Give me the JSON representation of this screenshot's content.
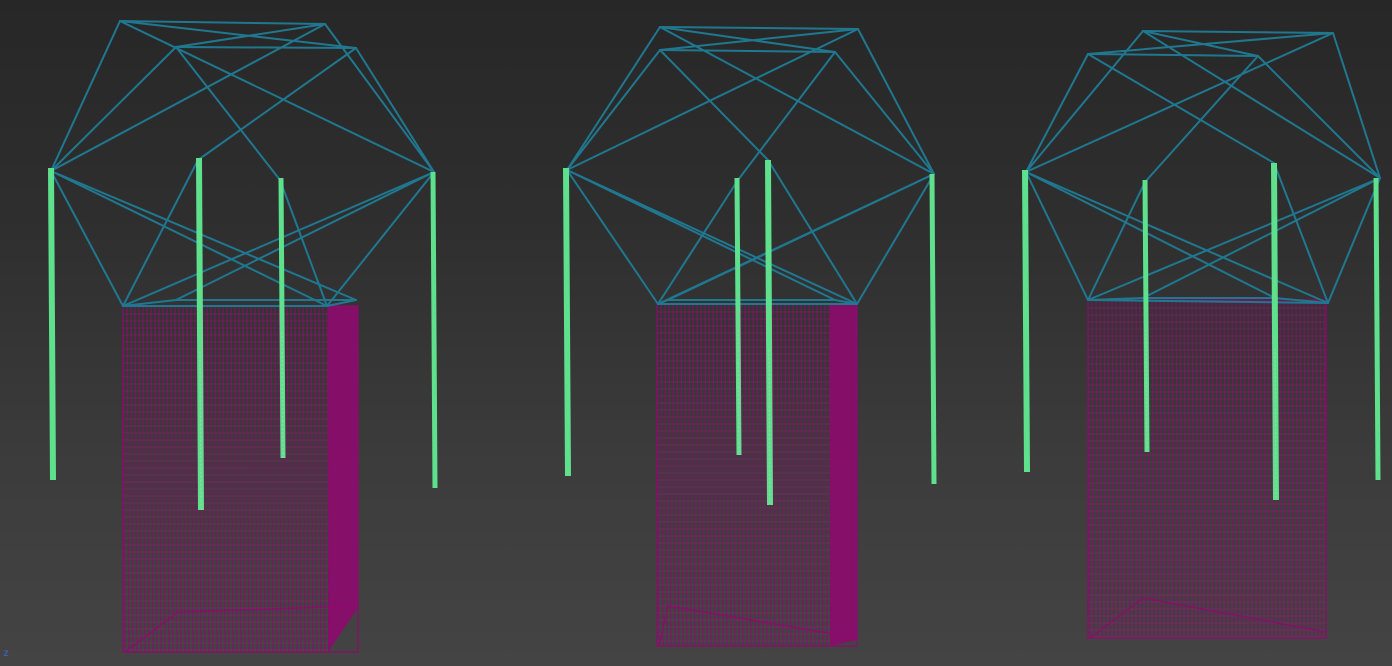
{
  "viewport": {
    "axis_indicator": "z"
  },
  "colors": {
    "background_top": "#272727",
    "background_bottom": "#444444",
    "frame_wire": "#1f7890",
    "cable": "#5fe08c",
    "cable_dim": "#cfcfcf",
    "grid_mesh": "#8e0a6e",
    "grid_mesh_light": "#a8287f",
    "axis": "#3d63d6"
  },
  "scene": {
    "object_types": [
      "cuboctahedron-frame",
      "hanging-cable",
      "grid-mesh-block"
    ],
    "frame_count": 3,
    "cables_per_frame": [
      4,
      4,
      4
    ]
  }
}
